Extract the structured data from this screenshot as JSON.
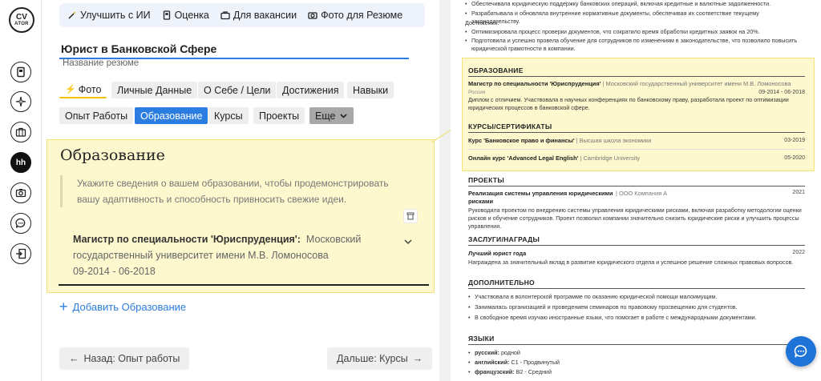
{
  "logo": {
    "line1": "CV",
    "line2": "ATOR"
  },
  "rail": {
    "hh_label": "hh"
  },
  "toolbar": {
    "improve_ai": "Улучшить с ИИ",
    "rating": "Оценка",
    "for_vacancy": "Для вакансии",
    "photo_resume": "Фото для Резюме"
  },
  "resume_title": {
    "value": "Юрист в Банковской Сфере",
    "hint": "Название резюме"
  },
  "tabs": [
    {
      "label": "Фото"
    },
    {
      "label": "Личные Данные"
    },
    {
      "label": "О Себе / Цели"
    },
    {
      "label": "Достижения"
    },
    {
      "label": "Навыки"
    },
    {
      "label": "Опыт Работы"
    },
    {
      "label": "Образование"
    },
    {
      "label": "Курсы"
    },
    {
      "label": "Проекты"
    },
    {
      "label": "Еще"
    }
  ],
  "section": {
    "title": "Образование",
    "hint": "Укажите сведения о вашем образовании, чтобы продемонстрировать вашу адаптивность и способность привносить свежие идеи.",
    "entry": {
      "degree": "Магистр по специальности 'Юриспруденция':",
      "university": "Московский государственный университет имени М.В. Ломоносова",
      "dates": "09-2014 - 06-2018"
    },
    "add_label": "Добавить Образование"
  },
  "nav": {
    "back": "Назад: Опыт работы",
    "next": "Дальше: Курсы"
  },
  "preview": {
    "top_bullets": [
      "Обеспечивала юридическую поддержку банковских операций, включая кредитные и валютные задолженности.",
      "Разрабатывала и обновляла внутренние нормативные документы, обеспечивая их соответствие текущему законодательству."
    ],
    "achievements_label": "Достижения:",
    "achievement_bullets": [
      "Оптимизировала процесс проверки документов, что сократило время обработки кредитных заявок на 20%.",
      "Подготовила и успешно провела обучение для сотрудников по изменениям в законодательстве, что позволило повысить юридической грамотности в компании."
    ],
    "education": {
      "heading": "ОБРАЗОВАНИЕ",
      "degree": "Магистр по специальности 'Юриспруденция'",
      "university": "Московский государственный университет имени М.В. Ломоносова",
      "country": "Россия",
      "dates": "09-2014 - 06-2018",
      "desc": "Диплом с отличием. Участвовала в научных конференциях по банковскому праву, разработала проект по оптимизации юридических процессов в банковской сфере."
    },
    "courses": {
      "heading": "КУРСЫ/СЕРТИФИКАТЫ",
      "items": [
        {
          "name": "Курс 'Банковское право и финансы'",
          "org": "Высшая школа экономики",
          "date": "03-2019"
        },
        {
          "name": "Онлайн курс 'Advanced Legal English'",
          "org": "Cambridge University",
          "date": "05-2020"
        }
      ]
    },
    "projects": {
      "heading": "ПРОЕКТЫ",
      "name_line1": "Реализация системы управления юридическими",
      "name_line2": "рисками",
      "org": "ООО Компания А",
      "year": "2021",
      "desc": "Руководила проектом по внедрению системы управления юридическими рисками, включая разработку методологии оценки рисков и обучение сотрудников. Проект позволил компании значительно снизить юридические риски и улучшить процессы управления."
    },
    "awards": {
      "heading": "ЗАСЛУГИ/НАГРАДЫ",
      "name": "Лучший юрист года",
      "year": "2022",
      "desc": "Награждена за значительный вклад в развитие юридического отдела и успешное решение сложных правовых вопросов."
    },
    "additional": {
      "heading": "ДОПОЛНИТЕЛЬНО",
      "items": [
        "Участвовала в волонтерской программе по оказанию юридической помощи малоимущим.",
        "Занималась организацией и проведением семинаров по правовому просвещению для студентов.",
        "В свободное время изучаю иностранные языки, что помогает в работе с международными документами."
      ]
    },
    "languages": {
      "heading": "ЯЗЫКИ",
      "items": [
        {
          "name": "русский:",
          "level": "родной"
        },
        {
          "name": "английский:",
          "level": "C1 - Продвинутый"
        },
        {
          "name": "французский:",
          "level": "B2 - Средний"
        }
      ]
    }
  },
  "colors": {
    "accent": "#2b7de1",
    "highlight": "#fdf8cd",
    "fab": "#1e73d8"
  }
}
